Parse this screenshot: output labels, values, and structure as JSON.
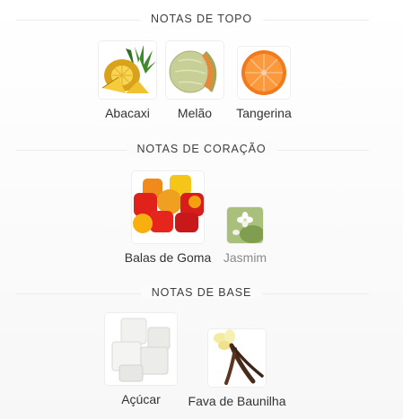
{
  "sections": [
    {
      "title": "NOTAS DE TOPO",
      "items": [
        {
          "name": "Abacaxi",
          "icon": "pineapple-icon"
        },
        {
          "name": "Melão",
          "icon": "melon-icon"
        },
        {
          "name": "Tangerina",
          "icon": "tangerine-icon"
        }
      ]
    },
    {
      "title": "NOTAS DE CORAÇÃO",
      "items": [
        {
          "name": "Balas de Goma",
          "icon": "gummy-candy-icon"
        },
        {
          "name": "Jasmim",
          "icon": "jasmine-icon"
        }
      ]
    },
    {
      "title": "NOTAS DE BASE",
      "items": [
        {
          "name": "Açúcar",
          "icon": "sugar-cubes-icon"
        },
        {
          "name": "Fava de Baunilha",
          "icon": "vanilla-bean-icon"
        }
      ]
    }
  ]
}
